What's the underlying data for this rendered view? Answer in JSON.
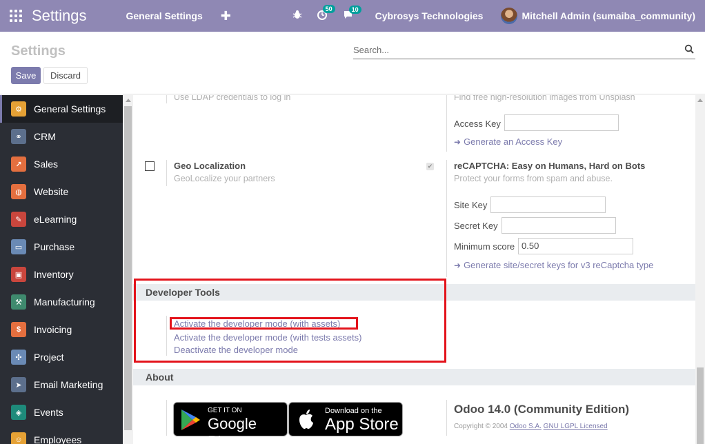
{
  "navbar": {
    "brand": "Settings",
    "menu_general": "General Settings",
    "activity_badge": "50",
    "messages_badge": "10",
    "company": "Cybrosys Technologies",
    "user": "Mitchell Admin (sumaiba_community)"
  },
  "control_panel": {
    "title": "Settings",
    "save_label": "Save",
    "discard_label": "Discard",
    "search_placeholder": "Search..."
  },
  "sidebar": {
    "items": [
      {
        "label": "General Settings",
        "color": "#e5a135"
      },
      {
        "label": "CRM",
        "color": "#5c6f8c"
      },
      {
        "label": "Sales",
        "color": "#e46f3f"
      },
      {
        "label": "Website",
        "color": "#e46f3f"
      },
      {
        "label": "eLearning",
        "color": "#c9463d"
      },
      {
        "label": "Purchase",
        "color": "#6a8ab5"
      },
      {
        "label": "Inventory",
        "color": "#c9463d"
      },
      {
        "label": "Manufacturing",
        "color": "#3f8a6e"
      },
      {
        "label": "Invoicing",
        "color": "#e46f3f"
      },
      {
        "label": "Project",
        "color": "#6a8ab5"
      },
      {
        "label": "Email Marketing",
        "color": "#5c6f8c"
      },
      {
        "label": "Events",
        "color": "#1e8b7b"
      },
      {
        "label": "Employees",
        "color": "#e5a135"
      }
    ]
  },
  "main": {
    "ldap_desc": "Use LDAP credentials to log in",
    "unsplash_desc": "Find free high-resolution images from Unsplash",
    "access_key_label": "Access Key",
    "access_key_link": "Generate an Access Key",
    "geo_title": "Geo Localization",
    "geo_desc": "GeoLocalize your partners",
    "recaptcha_title": "reCAPTCHA: Easy on Humans, Hard on Bots",
    "recaptcha_desc": "Protect your forms from spam and abuse.",
    "site_key_label": "Site Key",
    "secret_key_label": "Secret Key",
    "min_score_label": "Minimum score",
    "min_score_value": "0.50",
    "recaptcha_link": "Generate site/secret keys for v3 reCaptcha type",
    "dev_tools_title": "Developer Tools",
    "dev_link_assets": "Activate the developer mode (with assets)",
    "dev_link_tests": "Activate the developer mode (with tests assets)",
    "dev_link_deactivate": "Deactivate the developer mode",
    "about_title": "About",
    "google_small": "GET IT ON",
    "google_big": "Google Play",
    "apple_small": "Download on the",
    "apple_big": "App Store",
    "edition": "Odoo 14.0 (Community Edition)",
    "copyright_prefix": "Copyright © 2004",
    "copyright_company": "Odoo S.A.",
    "copyright_license": "GNU LGPL Licensed"
  },
  "colors": {
    "navbar": "#8f88b4",
    "accent": "#7c7bad",
    "highlight": "#e3131b"
  }
}
